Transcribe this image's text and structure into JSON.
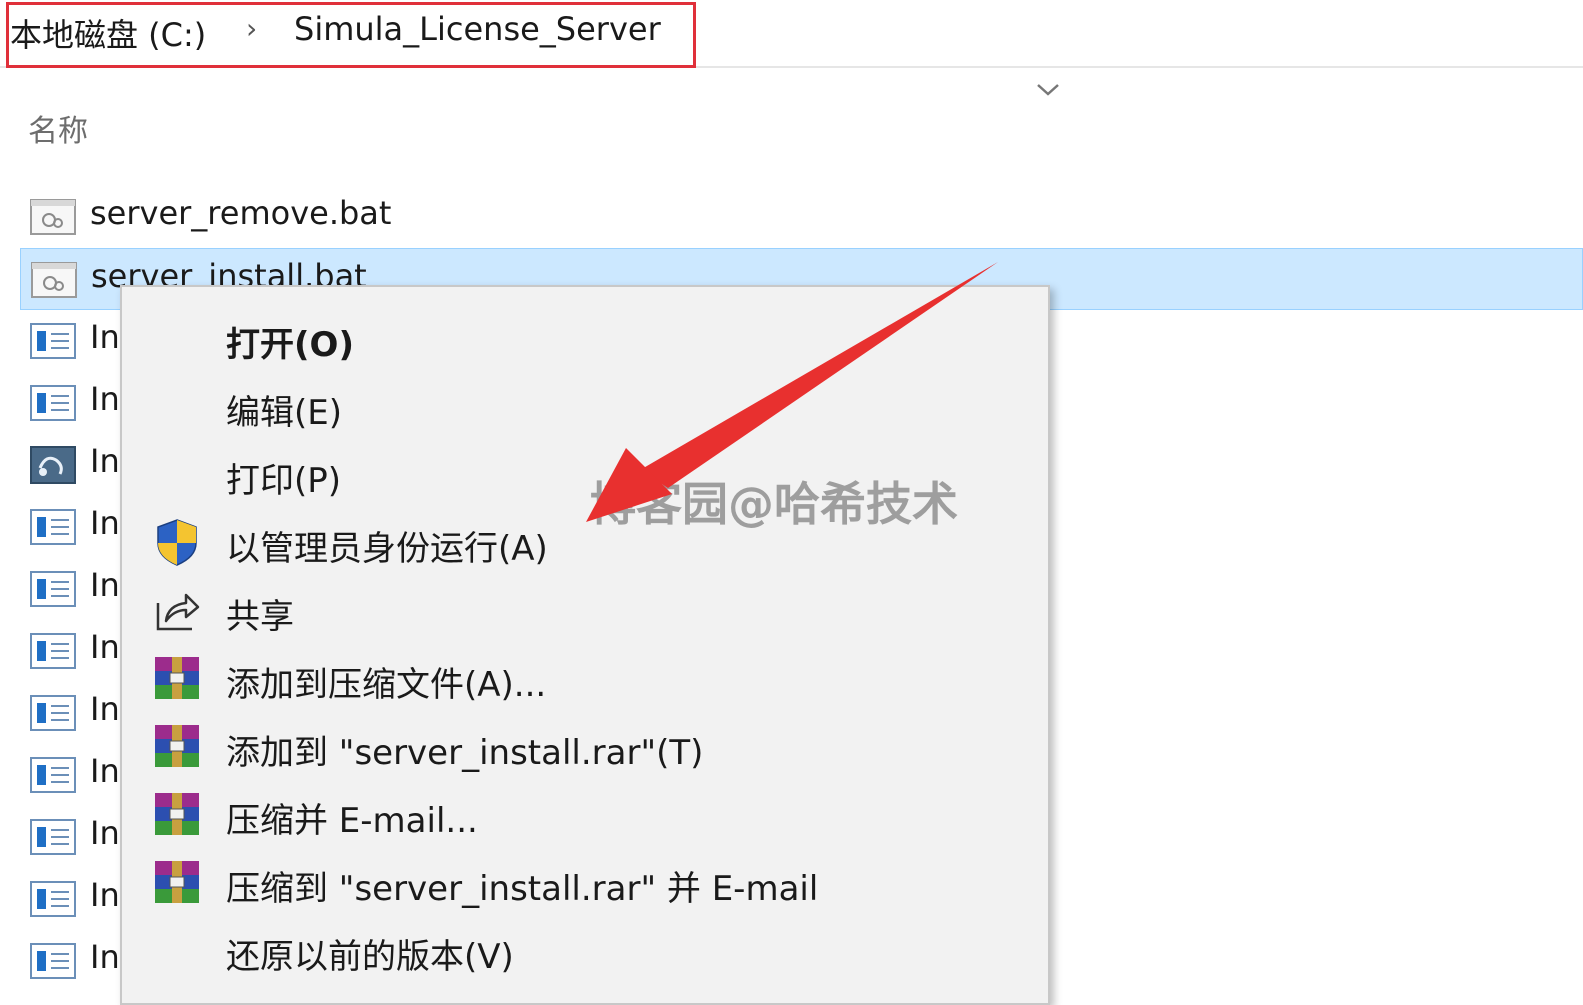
{
  "breadcrumb": {
    "drive": "本地磁盘 (C:)",
    "separator": "›",
    "folder": "Simula_License_Server"
  },
  "columns": {
    "name": "名称"
  },
  "files": [
    {
      "name": "server_remove.bat",
      "icon": "batch-file-icon",
      "selected": false
    },
    {
      "name": "server_install.bat",
      "icon": "batch-file-icon",
      "selected": true
    },
    {
      "name": "In",
      "icon": "document-icon"
    },
    {
      "name": "In",
      "icon": "document-icon"
    },
    {
      "name": "In",
      "icon": "executable-icon"
    },
    {
      "name": "In",
      "icon": "document-icon"
    },
    {
      "name": "In",
      "icon": "document-icon"
    },
    {
      "name": "In",
      "icon": "document-icon"
    },
    {
      "name": "In",
      "icon": "document-icon"
    },
    {
      "name": "In",
      "icon": "document-icon"
    },
    {
      "name": "In",
      "icon": "document-icon"
    },
    {
      "name": "In",
      "icon": "document-icon"
    },
    {
      "name": "In",
      "icon": "document-icon"
    }
  ],
  "context_menu": {
    "items": [
      {
        "label": "打开(O)",
        "icon": "",
        "bold": true
      },
      {
        "label": "编辑(E)",
        "icon": ""
      },
      {
        "label": "打印(P)",
        "icon": ""
      },
      {
        "label": "以管理员身份运行(A)",
        "icon": "uac-shield-icon"
      },
      {
        "label": "共享",
        "icon": "share-icon"
      },
      {
        "label": "添加到压缩文件(A)...",
        "icon": "winrar-icon"
      },
      {
        "label": "添加到 \"server_install.rar\"(T)",
        "icon": "winrar-icon"
      },
      {
        "label": "压缩并 E-mail...",
        "icon": "winrar-icon"
      },
      {
        "label": "压缩到 \"server_install.rar\" 并 E-mail",
        "icon": "winrar-icon"
      },
      {
        "label": "还原以前的版本(V)",
        "icon": ""
      }
    ]
  },
  "watermark": "博客园@哈希技术",
  "colors": {
    "highlight_box": "#e0303a",
    "selection": "#cce8ff",
    "arrow": "#e8302f"
  }
}
